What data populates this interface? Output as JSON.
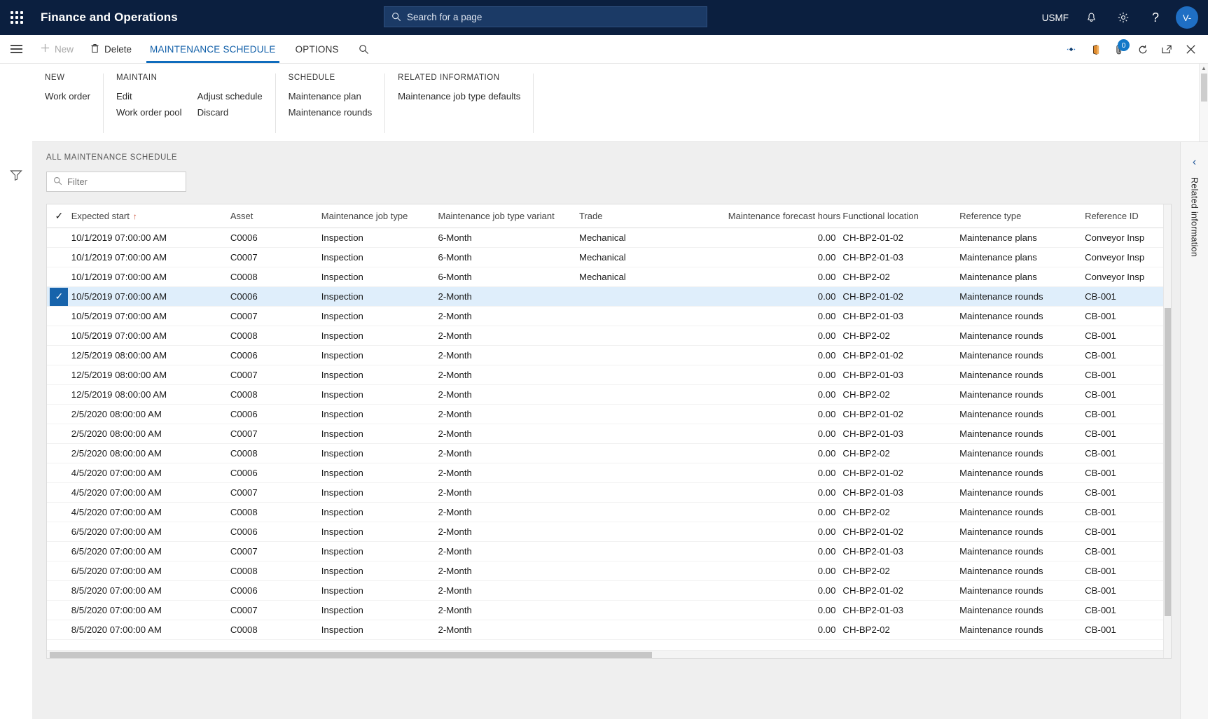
{
  "topbar": {
    "app_title": "Finance and Operations",
    "search_placeholder": "Search for a page",
    "company": "USMF",
    "avatar_initials": "V-",
    "icons": {
      "waffle": "app-launcher-icon",
      "search": "search-icon",
      "notifications": "bell-icon",
      "settings": "gear-icon",
      "help": "question-icon"
    }
  },
  "actionpane": {
    "new_label": "New",
    "delete_label": "Delete",
    "tab_maintenance_schedule": "MAINTENANCE SCHEDULE",
    "tab_options": "OPTIONS",
    "attachment_badge": "0"
  },
  "ribbon": {
    "groups": [
      {
        "title": "NEW",
        "columns": [
          {
            "items": [
              "Work order"
            ]
          }
        ]
      },
      {
        "title": "MAINTAIN",
        "columns": [
          {
            "items": [
              "Edit",
              "Work order pool"
            ]
          },
          {
            "items": [
              "Adjust schedule",
              "Discard"
            ]
          }
        ]
      },
      {
        "title": "SCHEDULE",
        "columns": [
          {
            "items": [
              "Maintenance plan",
              "Maintenance rounds"
            ]
          }
        ]
      },
      {
        "title": "RELATED INFORMATION",
        "columns": [
          {
            "items": [
              "Maintenance job type defaults"
            ]
          }
        ]
      }
    ]
  },
  "page": {
    "caption": "ALL MAINTENANCE SCHEDULE",
    "filter_placeholder": "Filter"
  },
  "grid": {
    "columns": [
      "Expected start",
      "Asset",
      "Maintenance job type",
      "Maintenance job type variant",
      "Trade",
      "Maintenance forecast hours",
      "Functional location",
      "Reference type",
      "Reference ID"
    ],
    "sort_column": "Expected start",
    "sort_direction": "ascending",
    "selected_row_index": 3,
    "rows": [
      {
        "expected_start": "10/1/2019 07:00:00 AM",
        "asset": "C0006",
        "job_type": "Inspection",
        "variant": "6-Month",
        "trade": "Mechanical",
        "forecast_hours": "0.00",
        "functional_location": "CH-BP2-01-02",
        "reference_type": "Maintenance plans",
        "reference_id": "Conveyor Insp"
      },
      {
        "expected_start": "10/1/2019 07:00:00 AM",
        "asset": "C0007",
        "job_type": "Inspection",
        "variant": "6-Month",
        "trade": "Mechanical",
        "forecast_hours": "0.00",
        "functional_location": "CH-BP2-01-03",
        "reference_type": "Maintenance plans",
        "reference_id": "Conveyor Insp"
      },
      {
        "expected_start": "10/1/2019 07:00:00 AM",
        "asset": "C0008",
        "job_type": "Inspection",
        "variant": "6-Month",
        "trade": "Mechanical",
        "forecast_hours": "0.00",
        "functional_location": "CH-BP2-02",
        "reference_type": "Maintenance plans",
        "reference_id": "Conveyor Insp"
      },
      {
        "expected_start": "10/5/2019 07:00:00 AM",
        "asset": "C0006",
        "job_type": "Inspection",
        "variant": "2-Month",
        "trade": "",
        "forecast_hours": "0.00",
        "functional_location": "CH-BP2-01-02",
        "reference_type": "Maintenance rounds",
        "reference_id": "CB-001"
      },
      {
        "expected_start": "10/5/2019 07:00:00 AM",
        "asset": "C0007",
        "job_type": "Inspection",
        "variant": "2-Month",
        "trade": "",
        "forecast_hours": "0.00",
        "functional_location": "CH-BP2-01-03",
        "reference_type": "Maintenance rounds",
        "reference_id": "CB-001"
      },
      {
        "expected_start": "10/5/2019 07:00:00 AM",
        "asset": "C0008",
        "job_type": "Inspection",
        "variant": "2-Month",
        "trade": "",
        "forecast_hours": "0.00",
        "functional_location": "CH-BP2-02",
        "reference_type": "Maintenance rounds",
        "reference_id": "CB-001"
      },
      {
        "expected_start": "12/5/2019 08:00:00 AM",
        "asset": "C0006",
        "job_type": "Inspection",
        "variant": "2-Month",
        "trade": "",
        "forecast_hours": "0.00",
        "functional_location": "CH-BP2-01-02",
        "reference_type": "Maintenance rounds",
        "reference_id": "CB-001"
      },
      {
        "expected_start": "12/5/2019 08:00:00 AM",
        "asset": "C0007",
        "job_type": "Inspection",
        "variant": "2-Month",
        "trade": "",
        "forecast_hours": "0.00",
        "functional_location": "CH-BP2-01-03",
        "reference_type": "Maintenance rounds",
        "reference_id": "CB-001"
      },
      {
        "expected_start": "12/5/2019 08:00:00 AM",
        "asset": "C0008",
        "job_type": "Inspection",
        "variant": "2-Month",
        "trade": "",
        "forecast_hours": "0.00",
        "functional_location": "CH-BP2-02",
        "reference_type": "Maintenance rounds",
        "reference_id": "CB-001"
      },
      {
        "expected_start": "2/5/2020 08:00:00 AM",
        "asset": "C0006",
        "job_type": "Inspection",
        "variant": "2-Month",
        "trade": "",
        "forecast_hours": "0.00",
        "functional_location": "CH-BP2-01-02",
        "reference_type": "Maintenance rounds",
        "reference_id": "CB-001"
      },
      {
        "expected_start": "2/5/2020 08:00:00 AM",
        "asset": "C0007",
        "job_type": "Inspection",
        "variant": "2-Month",
        "trade": "",
        "forecast_hours": "0.00",
        "functional_location": "CH-BP2-01-03",
        "reference_type": "Maintenance rounds",
        "reference_id": "CB-001"
      },
      {
        "expected_start": "2/5/2020 08:00:00 AM",
        "asset": "C0008",
        "job_type": "Inspection",
        "variant": "2-Month",
        "trade": "",
        "forecast_hours": "0.00",
        "functional_location": "CH-BP2-02",
        "reference_type": "Maintenance rounds",
        "reference_id": "CB-001"
      },
      {
        "expected_start": "4/5/2020 07:00:00 AM",
        "asset": "C0006",
        "job_type": "Inspection",
        "variant": "2-Month",
        "trade": "",
        "forecast_hours": "0.00",
        "functional_location": "CH-BP2-01-02",
        "reference_type": "Maintenance rounds",
        "reference_id": "CB-001"
      },
      {
        "expected_start": "4/5/2020 07:00:00 AM",
        "asset": "C0007",
        "job_type": "Inspection",
        "variant": "2-Month",
        "trade": "",
        "forecast_hours": "0.00",
        "functional_location": "CH-BP2-01-03",
        "reference_type": "Maintenance rounds",
        "reference_id": "CB-001"
      },
      {
        "expected_start": "4/5/2020 07:00:00 AM",
        "asset": "C0008",
        "job_type": "Inspection",
        "variant": "2-Month",
        "trade": "",
        "forecast_hours": "0.00",
        "functional_location": "CH-BP2-02",
        "reference_type": "Maintenance rounds",
        "reference_id": "CB-001"
      },
      {
        "expected_start": "6/5/2020 07:00:00 AM",
        "asset": "C0006",
        "job_type": "Inspection",
        "variant": "2-Month",
        "trade": "",
        "forecast_hours": "0.00",
        "functional_location": "CH-BP2-01-02",
        "reference_type": "Maintenance rounds",
        "reference_id": "CB-001"
      },
      {
        "expected_start": "6/5/2020 07:00:00 AM",
        "asset": "C0007",
        "job_type": "Inspection",
        "variant": "2-Month",
        "trade": "",
        "forecast_hours": "0.00",
        "functional_location": "CH-BP2-01-03",
        "reference_type": "Maintenance rounds",
        "reference_id": "CB-001"
      },
      {
        "expected_start": "6/5/2020 07:00:00 AM",
        "asset": "C0008",
        "job_type": "Inspection",
        "variant": "2-Month",
        "trade": "",
        "forecast_hours": "0.00",
        "functional_location": "CH-BP2-02",
        "reference_type": "Maintenance rounds",
        "reference_id": "CB-001"
      },
      {
        "expected_start": "8/5/2020 07:00:00 AM",
        "asset": "C0006",
        "job_type": "Inspection",
        "variant": "2-Month",
        "trade": "",
        "forecast_hours": "0.00",
        "functional_location": "CH-BP2-01-02",
        "reference_type": "Maintenance rounds",
        "reference_id": "CB-001"
      },
      {
        "expected_start": "8/5/2020 07:00:00 AM",
        "asset": "C0007",
        "job_type": "Inspection",
        "variant": "2-Month",
        "trade": "",
        "forecast_hours": "0.00",
        "functional_location": "CH-BP2-01-03",
        "reference_type": "Maintenance rounds",
        "reference_id": "CB-001"
      },
      {
        "expected_start": "8/5/2020 07:00:00 AM",
        "asset": "C0008",
        "job_type": "Inspection",
        "variant": "2-Month",
        "trade": "",
        "forecast_hours": "0.00",
        "functional_location": "CH-BP2-02",
        "reference_type": "Maintenance rounds",
        "reference_id": "CB-001"
      }
    ]
  },
  "rightrail": {
    "label": "Related information"
  },
  "colors": {
    "brand_navy": "#0b1f3f",
    "accent_blue": "#0f6cbd",
    "selected_row": "#dfeefb",
    "check_blue": "#1763ab"
  }
}
